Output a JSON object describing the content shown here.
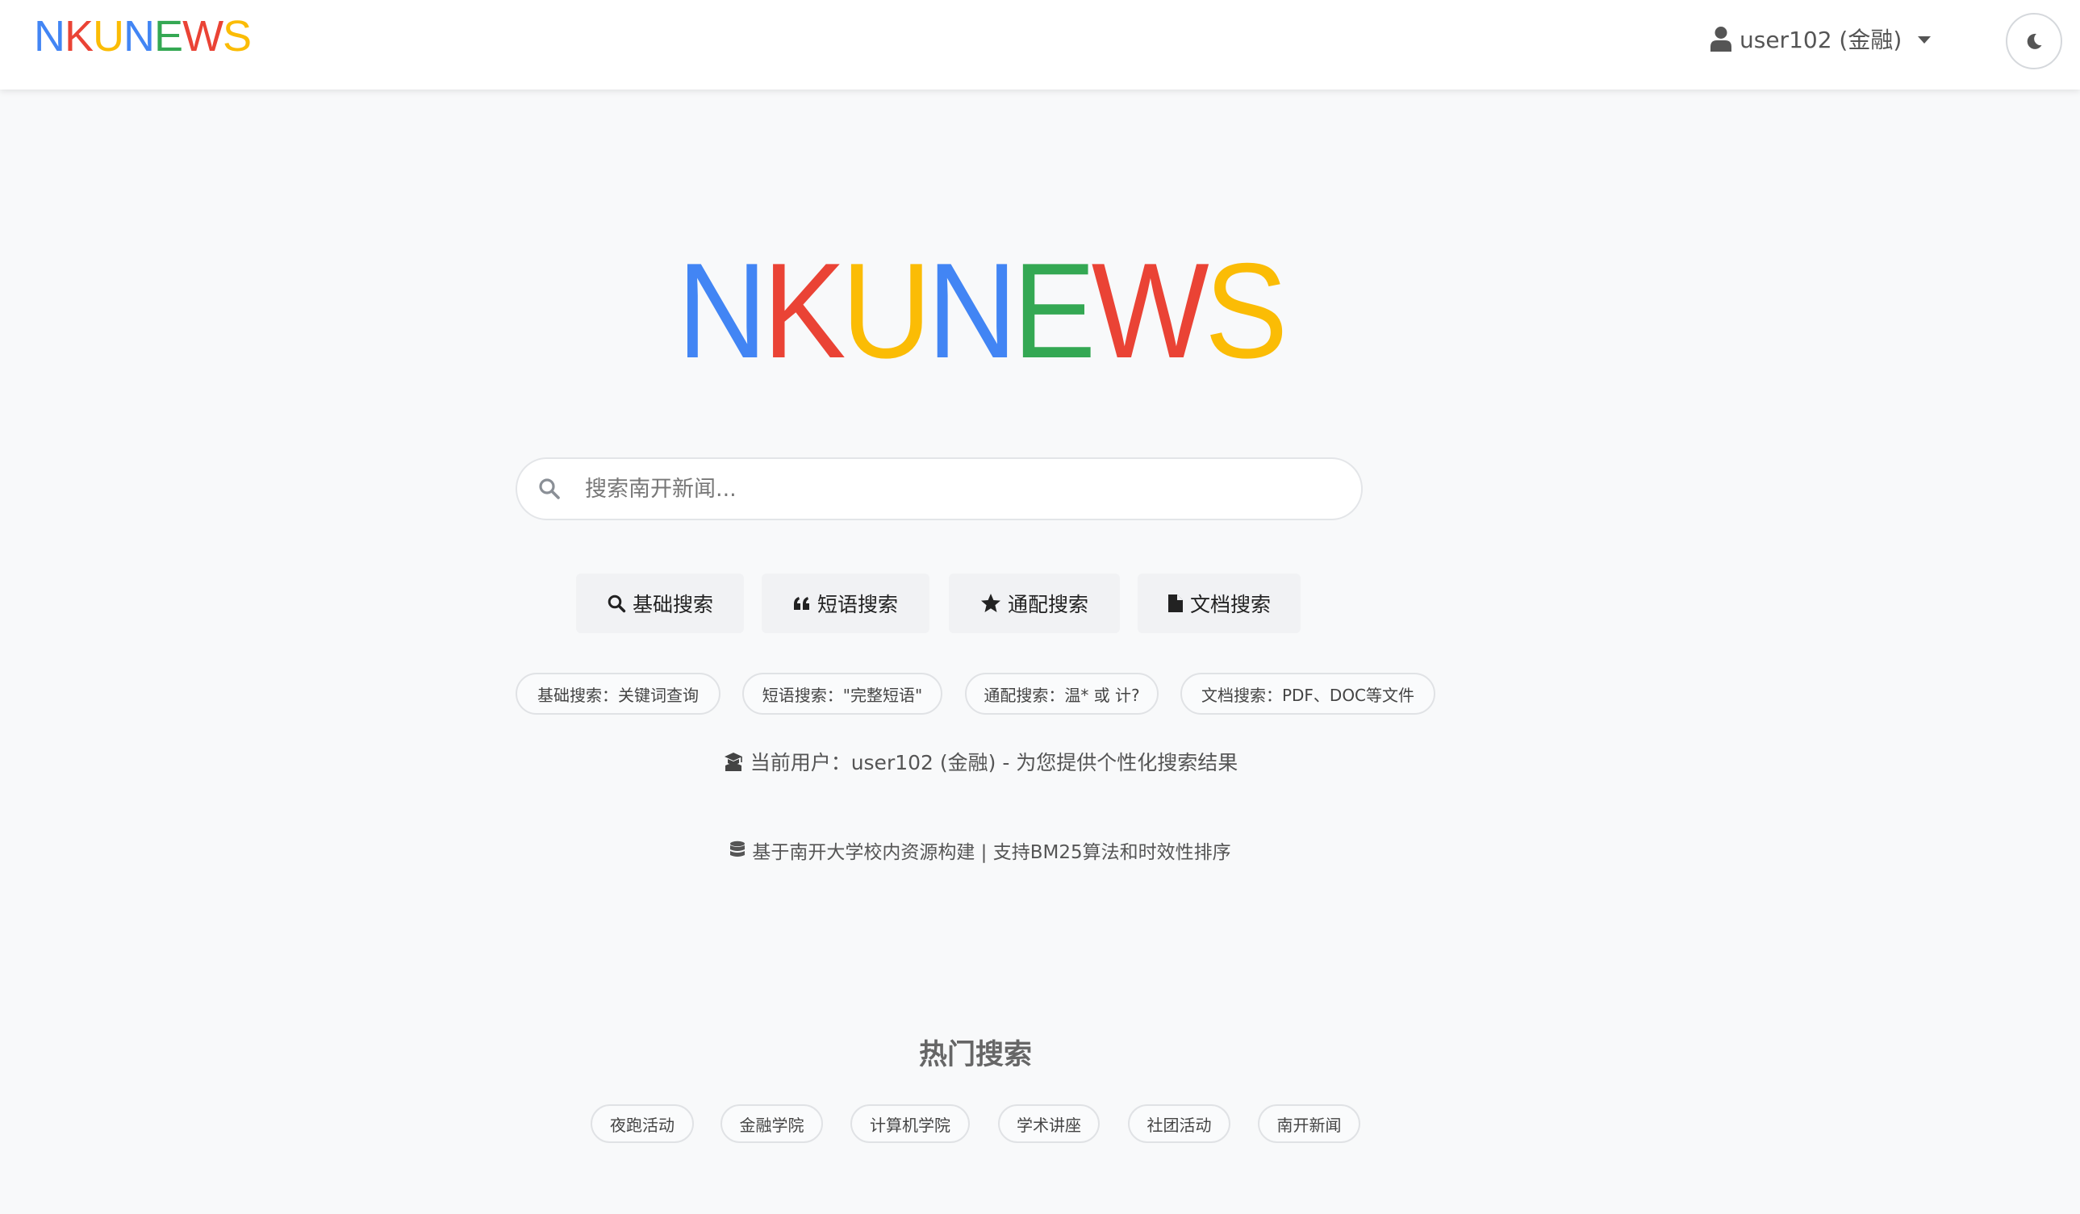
{
  "header": {
    "brand_letters": [
      {
        "char": "N",
        "color": "#4285f4"
      },
      {
        "char": "K",
        "color": "#ea4335"
      },
      {
        "char": "U",
        "color": "#fbbc05"
      },
      {
        "char": "N",
        "color": "#4285f4"
      },
      {
        "char": "E",
        "color": "#34a853"
      },
      {
        "char": "W",
        "color": "#ea4335"
      },
      {
        "char": "S",
        "color": "#fbbc05"
      }
    ],
    "user_label": "user102 (金融)",
    "user_icon": "user-icon",
    "dropdown_icon": "caret-down-icon",
    "theme_icon": "moon-icon"
  },
  "hero": {
    "logo_letters": [
      {
        "char": "N",
        "color": "#4285f4"
      },
      {
        "char": "K",
        "color": "#ea4335"
      },
      {
        "char": "U",
        "color": "#fbbc05"
      },
      {
        "char": "N",
        "color": "#4285f4"
      },
      {
        "char": "E",
        "color": "#34a853"
      },
      {
        "char": "W",
        "color": "#ea4335"
      },
      {
        "char": "S",
        "color": "#fbbc05"
      }
    ]
  },
  "search": {
    "placeholder": "搜索南开新闻...",
    "value": "",
    "icon": "search-icon"
  },
  "modes": [
    {
      "label": "基础搜索",
      "icon": "search-icon"
    },
    {
      "label": "短语搜索",
      "icon": "quote-icon"
    },
    {
      "label": "通配搜索",
      "icon": "star-icon"
    },
    {
      "label": "文档搜索",
      "icon": "file-icon"
    }
  ],
  "hints": [
    "基础搜索：关键词查询",
    "短语搜索：\"完整短语\"",
    "通配搜索：温* 或 计?",
    "文档搜索：PDF、DOC等文件"
  ],
  "current_user_text": "当前用户：user102 (金融) - 为您提供个性化搜索结果",
  "data_source_text": "基于南开大学校内资源构建 | 支持BM25算法和时效性排序",
  "hot": {
    "title": "热门搜索",
    "items": [
      "夜跑活动",
      "金融学院",
      "计算机学院",
      "学术讲座",
      "社团活动",
      "南开新闻"
    ]
  },
  "colors": {
    "blue": "#4285f4",
    "red": "#ea4335",
    "yellow": "#fbbc05",
    "green": "#34a853",
    "background": "#f8f9fa"
  }
}
